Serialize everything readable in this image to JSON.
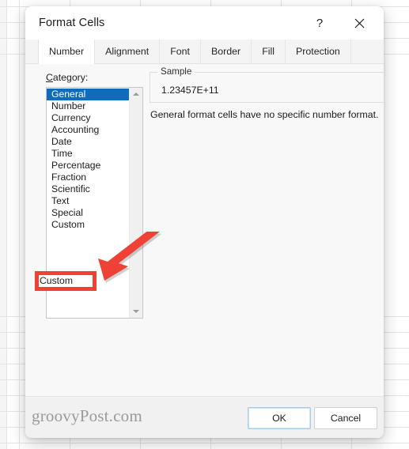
{
  "window": {
    "title": "Format Cells",
    "help_icon": "question-mark-icon",
    "close_icon": "close-icon"
  },
  "tabs": [
    {
      "label": "Number",
      "active": true
    },
    {
      "label": "Alignment",
      "active": false
    },
    {
      "label": "Font",
      "active": false
    },
    {
      "label": "Border",
      "active": false
    },
    {
      "label": "Fill",
      "active": false
    },
    {
      "label": "Protection",
      "active": false
    }
  ],
  "category": {
    "label_prefix": "C",
    "label_rest": "ategory:",
    "items": [
      {
        "label": "General",
        "selected": true
      },
      {
        "label": "Number",
        "selected": false
      },
      {
        "label": "Currency",
        "selected": false
      },
      {
        "label": "Accounting",
        "selected": false
      },
      {
        "label": "Date",
        "selected": false
      },
      {
        "label": "Time",
        "selected": false
      },
      {
        "label": "Percentage",
        "selected": false
      },
      {
        "label": "Fraction",
        "selected": false
      },
      {
        "label": "Scientific",
        "selected": false
      },
      {
        "label": "Text",
        "selected": false
      },
      {
        "label": "Special",
        "selected": false
      },
      {
        "label": "Custom",
        "selected": false
      }
    ],
    "scroll_up_icon": "triangle-up-icon",
    "scroll_down_icon": "triangle-down-icon"
  },
  "sample": {
    "legend": "Sample",
    "value": "1.23457E+11"
  },
  "description": "General format cells have no specific number format.",
  "footer": {
    "watermark": "groovyPost.com",
    "ok_label": "OK",
    "cancel_label": "Cancel"
  },
  "annotation": {
    "highlight_target": "Custom",
    "highlight_color": "#ef4136",
    "arrow_color": "#ef4136",
    "arrow_icon": "arrow-pointing-down-left-icon"
  },
  "colors": {
    "selection_blue": "#0f6cbd",
    "dialog_background": "#f8f8f8",
    "titlebar_background": "#ffffff",
    "annotation_red": "#ef4136"
  }
}
